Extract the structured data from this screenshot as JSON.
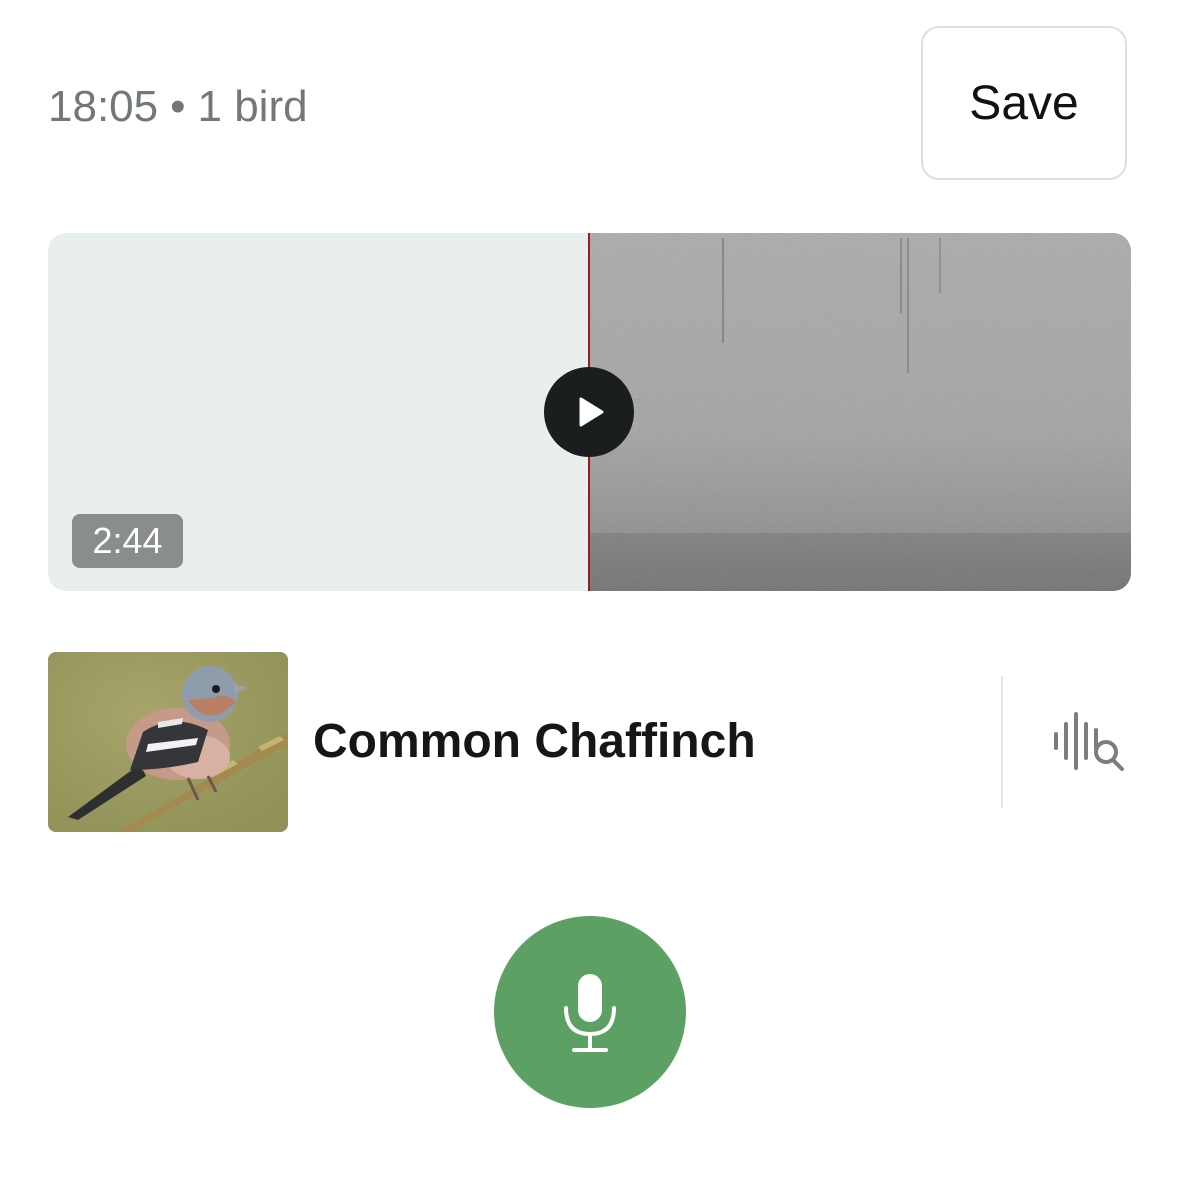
{
  "header": {
    "time": "18:05",
    "separator": "•",
    "bird_count": "1 bird",
    "save_label": "Save"
  },
  "player": {
    "duration": "2:44",
    "play_icon": "play-icon"
  },
  "result": {
    "species": "Common Chaffinch",
    "thumbnail_icon": "bird-photo",
    "analyze_icon": "waveform-search-icon"
  },
  "record": {
    "icon": "microphone-icon"
  },
  "colors": {
    "accent_green": "#5ca163",
    "playhead_red": "#9b1c1c",
    "player_bg": "#e9efed",
    "text_muted": "#72777a"
  }
}
